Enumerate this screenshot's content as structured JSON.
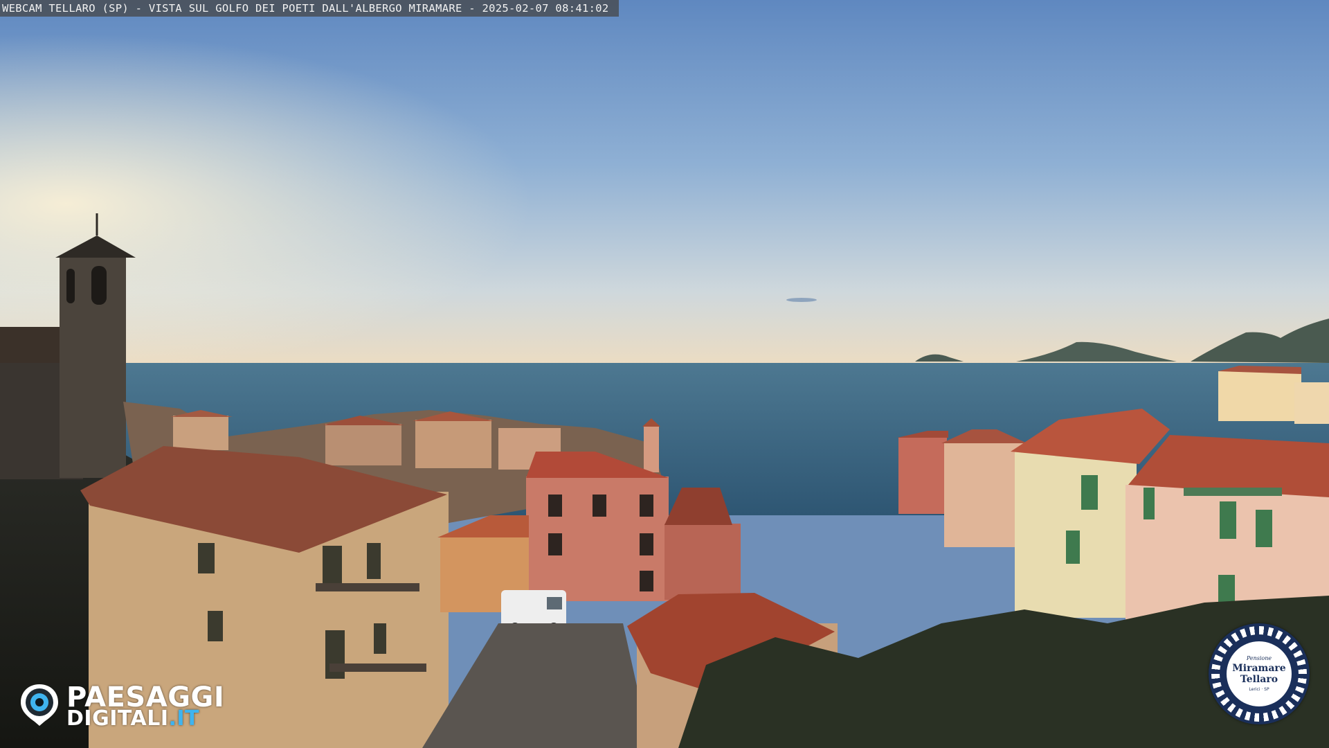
{
  "caption": "WEBCAM TELLARO (SP) - VISTA SUL GOLFO DEI POETI DALL'ALBERGO MIRAMARE - 2025-02-07 08:41:02",
  "brand": {
    "line1": "PAESAGGI",
    "line2_main": "DIGITALI",
    "line2_suffix": ".IT",
    "icon": "eye-pin-icon"
  },
  "hotel_logo": {
    "small": "Pensione",
    "name_line1": "Miramare",
    "name_line2": "Tellaro",
    "footer": "Lerici · SP"
  },
  "colors": {
    "sky_top": "#6a8ec0",
    "sky_horizon": "#e9dcc4",
    "sea": "#3f6a86",
    "brand_accent": "#3fb4f0",
    "badge_navy": "#1a2f5a"
  }
}
